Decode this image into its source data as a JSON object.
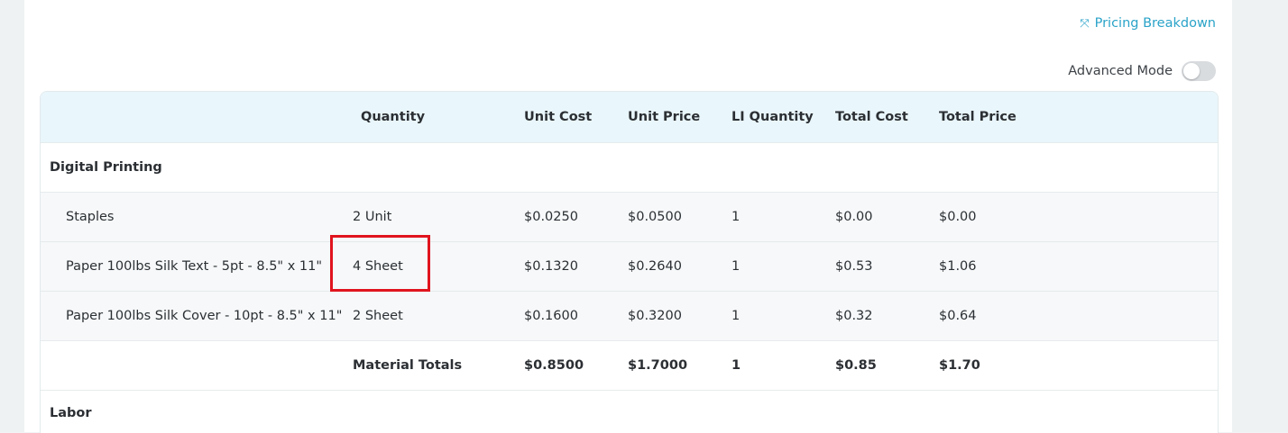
{
  "header": {
    "pricing_breakdown": "Pricing Breakdown",
    "pricing_breakdown_icon": "collapse-arrows-icon",
    "advanced_mode_label": "Advanced Mode",
    "advanced_mode_on": false
  },
  "table": {
    "columns": [
      "",
      "Quantity",
      "Unit Cost",
      "Unit Price",
      "LI Quantity",
      "Total Cost",
      "Total Price"
    ],
    "groups": [
      {
        "name": "Digital Printing",
        "items": [
          {
            "name": "Staples",
            "quantity": "2 Unit",
            "unit_cost": "$0.0250",
            "unit_price": "$0.0500",
            "li_quantity": "1",
            "total_cost": "$0.00",
            "total_price": "$0.00"
          },
          {
            "name": "Paper 100lbs Silk Text - 5pt - 8.5\" x 11\"",
            "quantity": "4 Sheet",
            "unit_cost": "$0.1320",
            "unit_price": "$0.2640",
            "li_quantity": "1",
            "total_cost": "$0.53",
            "total_price": "$1.06"
          },
          {
            "name": "Paper 100lbs Silk Cover - 10pt - 8.5\" x 11\"",
            "quantity": "2 Sheet",
            "unit_cost": "$0.1600",
            "unit_price": "$0.3200",
            "li_quantity": "1",
            "total_cost": "$0.32",
            "total_price": "$0.64"
          }
        ],
        "totals": {
          "label": "Material Totals",
          "unit_cost": "$0.8500",
          "unit_price": "$1.7000",
          "li_quantity": "1",
          "total_cost": "$0.85",
          "total_price": "$1.70"
        }
      },
      {
        "name": "Labor"
      }
    ]
  },
  "colors": {
    "accent": "#2aa3c8",
    "highlight": "#e0141e",
    "header_bg": "#e9f6fb"
  }
}
